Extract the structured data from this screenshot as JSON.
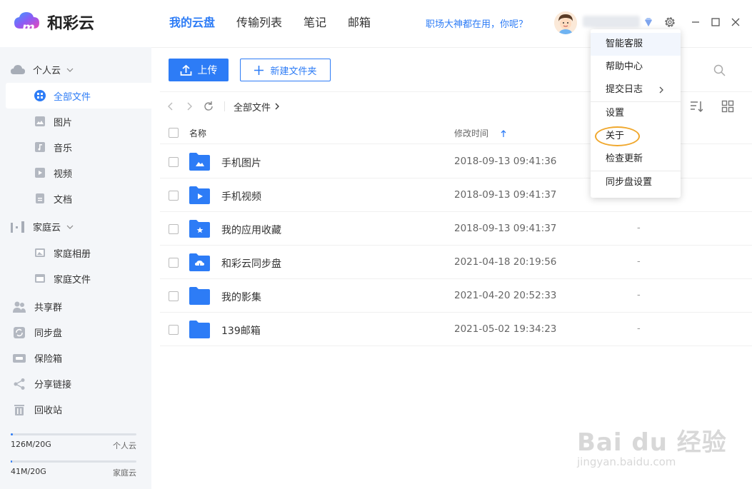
{
  "app": {
    "name": "和彩云",
    "nav": [
      "我的云盘",
      "传输列表",
      "笔记",
      "邮箱"
    ],
    "active_nav": "我的云盘",
    "slogan": "职场大神都在用，你呢？"
  },
  "sidebar": {
    "personal_cloud": {
      "label": "个人云",
      "items": [
        "全部文件",
        "图片",
        "音乐",
        "视频",
        "文档"
      ],
      "active": "全部文件"
    },
    "family_cloud": {
      "label": "家庭云",
      "items": [
        "家庭相册",
        "家庭文件"
      ]
    },
    "other_items": [
      "共享群",
      "同步盘",
      "保险箱",
      "分享链接",
      "回收站"
    ],
    "storage": [
      {
        "used": "126M/20G",
        "label": "个人云",
        "fraction": 0.006
      },
      {
        "used": "41M/20G",
        "label": "家庭云",
        "fraction": 0.002
      }
    ]
  },
  "toolbar": {
    "upload_label": "上传",
    "new_folder_label": "新建文件夹"
  },
  "breadcrumb": {
    "current": "全部文件"
  },
  "table": {
    "headers": {
      "name": "名称",
      "modified": "修改时间"
    },
    "rows": [
      {
        "name": "手机图片",
        "modified": "2018-09-13 09:41:36",
        "size": "-",
        "icon": "folder-image-icon"
      },
      {
        "name": "手机视频",
        "modified": "2018-09-13 09:41:37",
        "size": "-",
        "icon": "folder-video-icon"
      },
      {
        "name": "我的应用收藏",
        "modified": "2018-09-13 09:41:37",
        "size": "-",
        "icon": "folder-star-icon"
      },
      {
        "name": "和彩云同步盘",
        "modified": "2021-04-18 20:19:56",
        "size": "-",
        "icon": "folder-sync-icon"
      },
      {
        "name": "我的影集",
        "modified": "2021-04-20 20:52:33",
        "size": "-",
        "icon": "folder-icon"
      },
      {
        "name": "139邮箱",
        "modified": "2021-05-02 19:34:23",
        "size": "-",
        "icon": "folder-icon"
      }
    ]
  },
  "settings_menu": {
    "items": [
      "智能客服",
      "帮助中心",
      "提交日志",
      "设置",
      "关于",
      "检查更新",
      "同步盘设置"
    ],
    "highlighted": "关于"
  },
  "watermark": {
    "brand": "Bai du 经验",
    "url": "jingyan.baidu.com"
  },
  "colors": {
    "accent": "#2d7cf6",
    "sidebar_bg": "#f4f6f9",
    "highlight_circle": "#f0a82e"
  }
}
